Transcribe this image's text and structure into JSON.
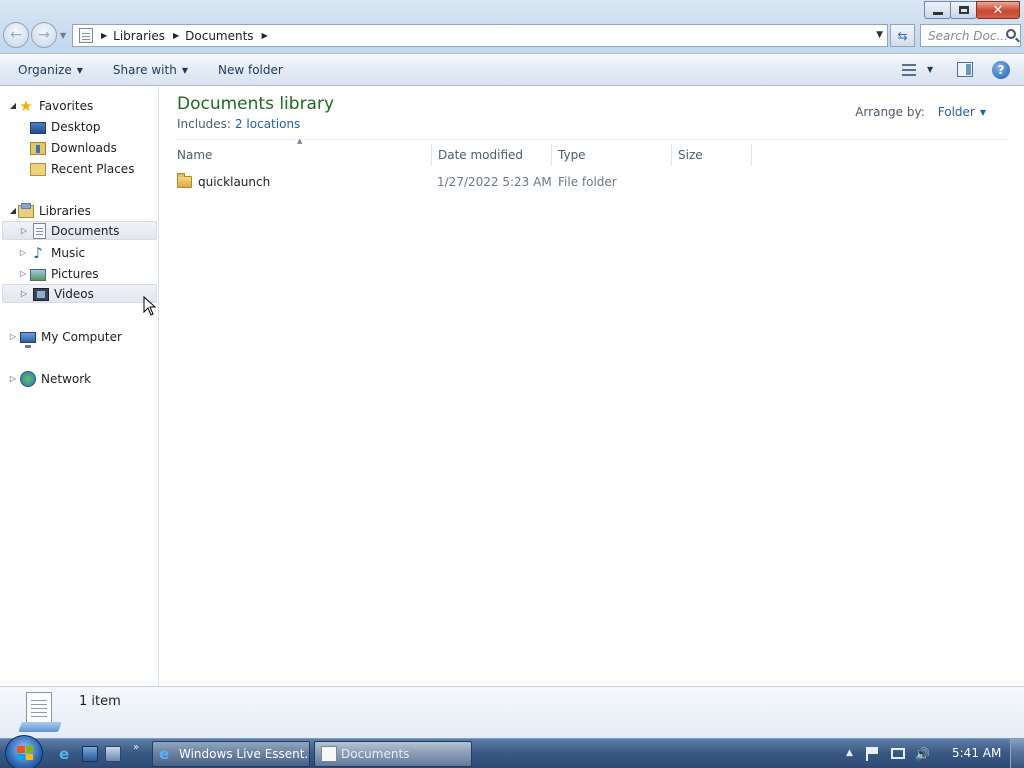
{
  "address": {
    "crumbs": [
      "Libraries",
      "Documents"
    ],
    "search_placeholder": "Search Doc..."
  },
  "toolbar": {
    "organize": "Organize",
    "share_with": "Share with",
    "new_folder": "New folder"
  },
  "nav": {
    "favorites": "Favorites",
    "desktop": "Desktop",
    "downloads": "Downloads",
    "recent_places": "Recent Places",
    "libraries": "Libraries",
    "documents": "Documents",
    "music": "Music",
    "pictures": "Pictures",
    "videos": "Videos",
    "my_computer": "My Computer",
    "network": "Network"
  },
  "content": {
    "title": "Documents library",
    "includes_label": "Includes:",
    "includes_link": "2 locations",
    "arrange_label": "Arrange by:",
    "arrange_value": "Folder",
    "columns": {
      "name": "Name",
      "date_modified": "Date modified",
      "type": "Type",
      "size": "Size"
    },
    "rows": [
      {
        "name": "quicklaunch",
        "date_modified": "1/27/2022 5:23 AM",
        "type": "File folder",
        "size": ""
      }
    ]
  },
  "details": {
    "count": "1 item"
  },
  "taskbar": {
    "buttons": [
      "Windows Live Essent...",
      "Documents"
    ],
    "clock": "5:41 AM"
  }
}
